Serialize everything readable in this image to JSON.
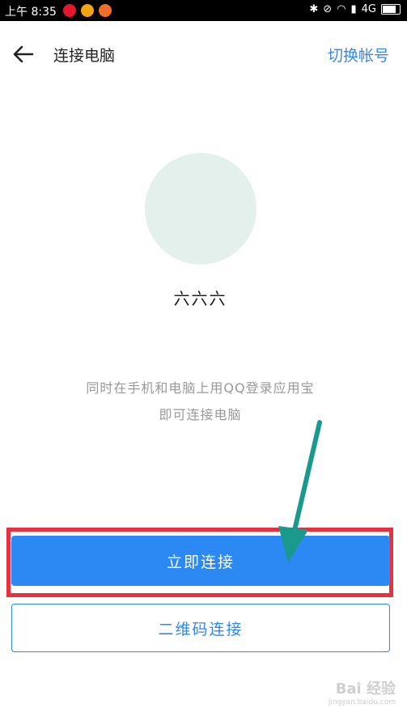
{
  "status_bar": {
    "time": "上午 8:35",
    "network": "4G",
    "app_icons": [
      "weibo-icon",
      "browser-icon",
      "app-icon"
    ]
  },
  "header": {
    "title": "连接电脑",
    "switch_account": "切换帐号"
  },
  "profile": {
    "username": "六六六",
    "avatar_color": "#e4f0ec"
  },
  "instructions": {
    "line1": "同时在手机和电脑上用QQ登录应用宝",
    "line2": "即可连接电脑"
  },
  "actions": {
    "connect_now": "立即连接",
    "qr_connect": "二维码连接"
  },
  "watermark": {
    "brand": "Bai 经验",
    "url": "jingyan.baidu.com"
  },
  "colors": {
    "accent": "#2c88f2",
    "highlight_border": "#e8313e",
    "annotation_arrow": "#1a9a8c"
  }
}
